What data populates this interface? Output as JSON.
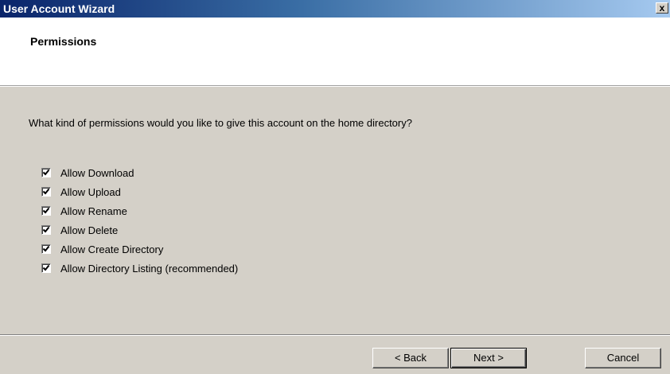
{
  "window": {
    "title": "User Account Wizard",
    "close_glyph": "x"
  },
  "header": {
    "title": "Permissions"
  },
  "body": {
    "question": "What kind of permissions would you like to give this account on the home directory?",
    "permissions": [
      {
        "label": "Allow Download",
        "checked": true
      },
      {
        "label": "Allow Upload",
        "checked": true
      },
      {
        "label": "Allow Rename",
        "checked": true
      },
      {
        "label": "Allow Delete",
        "checked": true
      },
      {
        "label": "Allow Create Directory",
        "checked": true
      },
      {
        "label": "Allow Directory Listing (recommended)",
        "checked": true
      }
    ]
  },
  "buttons": {
    "back_label": "< Back",
    "next_label": "Next >",
    "cancel_label": "Cancel"
  },
  "colors": {
    "dialog_bg": "#d4d0c8",
    "titlebar_start": "#0a246a",
    "titlebar_end": "#a6caf0"
  }
}
